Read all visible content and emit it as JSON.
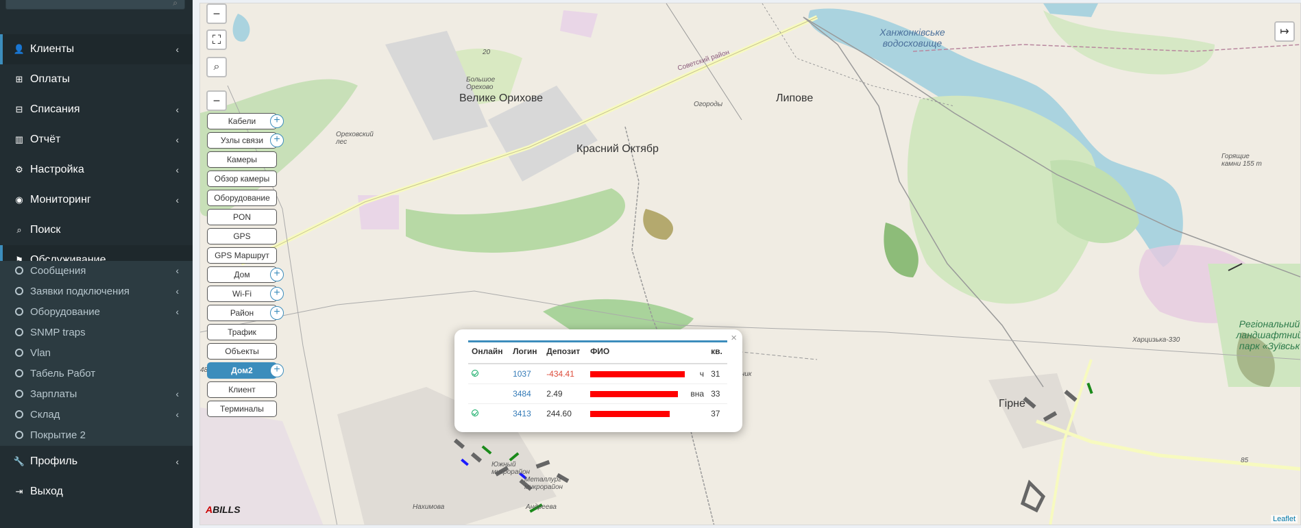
{
  "sidebar": {
    "items": [
      {
        "label": "Клиенты",
        "icon": "user-icon",
        "glyph": "👤",
        "chevron": true,
        "active": true
      },
      {
        "label": "Оплаты",
        "icon": "plus-square-icon",
        "glyph": "⊞",
        "chevron": false
      },
      {
        "label": "Списания",
        "icon": "minus-square-icon",
        "glyph": "⊟",
        "chevron": true
      },
      {
        "label": "Отчёт",
        "icon": "bar-chart-icon",
        "glyph": "▥",
        "chevron": true
      },
      {
        "label": "Настройка",
        "icon": "gear-icon",
        "glyph": "⚙",
        "chevron": true
      },
      {
        "label": "Мониторинг",
        "icon": "eye-icon",
        "glyph": "◉",
        "chevron": true
      },
      {
        "label": "Поиск",
        "icon": "search-icon",
        "glyph": "⌕",
        "chevron": false
      },
      {
        "label": "Обслуживание",
        "icon": "flag-icon",
        "glyph": "⚑",
        "chevron": true,
        "expanded": true
      }
    ],
    "subitems": [
      {
        "label": "Сообщения",
        "chevron": true
      },
      {
        "label": "Заявки подключения",
        "chevron": true
      },
      {
        "label": "Оборудование",
        "chevron": true
      },
      {
        "label": "SNMP traps",
        "chevron": false
      },
      {
        "label": "Vlan",
        "chevron": false
      },
      {
        "label": "Табель Работ",
        "chevron": false
      },
      {
        "label": "Зарплаты",
        "chevron": true
      },
      {
        "label": "Склад",
        "chevron": true
      },
      {
        "label": "Покрытие 2",
        "chevron": false
      }
    ],
    "bottom": [
      {
        "label": "Профиль",
        "icon": "wrench-icon",
        "glyph": "🔧",
        "chevron": true
      },
      {
        "label": "Выход",
        "icon": "sign-out-icon",
        "glyph": "⇥",
        "chevron": false
      }
    ]
  },
  "map_controls": {
    "zoom_out": "−",
    "fullscreen": "⛶",
    "search": "⌕",
    "collapse": "−",
    "expand": "↦"
  },
  "layers": [
    {
      "label": "Кабели",
      "plus": true
    },
    {
      "label": "Узлы связи",
      "plus": true
    },
    {
      "label": "Камеры",
      "plus": false
    },
    {
      "label": "Обзор камеры",
      "plus": false
    },
    {
      "label": "Оборудование",
      "plus": false
    },
    {
      "label": "PON",
      "plus": false
    },
    {
      "label": "GPS",
      "plus": false
    },
    {
      "label": "GPS Маршрут",
      "plus": false
    },
    {
      "label": "Дом",
      "plus": true
    },
    {
      "label": "Wi-Fi",
      "plus": true
    },
    {
      "label": "Район",
      "plus": true
    },
    {
      "label": "Трафик",
      "plus": false
    },
    {
      "label": "Объекты",
      "plus": false
    },
    {
      "label": "Дом2",
      "plus": true,
      "active": true
    },
    {
      "label": "Клиент",
      "plus": false
    },
    {
      "label": "Терминалы",
      "plus": false
    }
  ],
  "popup": {
    "close": "×",
    "headers": [
      "Онлайн",
      "Логин",
      "Депозит",
      "ФИО",
      "кв."
    ],
    "rows": [
      {
        "online": true,
        "login": "1037",
        "deposit": "-434.41",
        "negative": true,
        "fio_tail": "ч",
        "flat": "31",
        "bar_fraction": 0.83
      },
      {
        "online": false,
        "login": "3484",
        "deposit": "2.49",
        "negative": false,
        "fio_tail": "вна",
        "flat": "33",
        "bar_fraction": 0.77
      },
      {
        "online": true,
        "login": "3413",
        "deposit": "244.60",
        "negative": false,
        "fio_tail": "",
        "flat": "37",
        "bar_fraction": 0.7
      }
    ]
  },
  "map_labels": {
    "velyke": "Велике Орихове",
    "krasny": "Красний Октябр",
    "lypove": "Липове",
    "hirne": "Гірне",
    "reservoir": "Ханжонківське водосховище",
    "bolshoe": "Большое Орехово",
    "orekhovsky": "Ореховский лес",
    "ogorody": "Огороды",
    "sovetsky": "Советский район",
    "park": "Регіональний ландшафтний парк «Зуївськ",
    "goryashchie": "Горящие камни 155 m",
    "kharcyzka": "Харцизька-330",
    "elev20": "20",
    "elev48": "48",
    "elev85": "85",
    "yuzhny": "Южный микрорайон",
    "metallurg": "Металлург микрорайон",
    "nakhimova": "Нахимова",
    "andreeva": "Андреева",
    "ochnik": "ичник"
  },
  "attribution": "Leaflet",
  "logo": {
    "a": "A",
    "rest": "BILLS"
  },
  "colors": {
    "sidebar": "#222d32",
    "accent": "#3c8dbc",
    "negative": "#dd4b39",
    "online": "#00a65a",
    "redact": "#ff0000"
  }
}
